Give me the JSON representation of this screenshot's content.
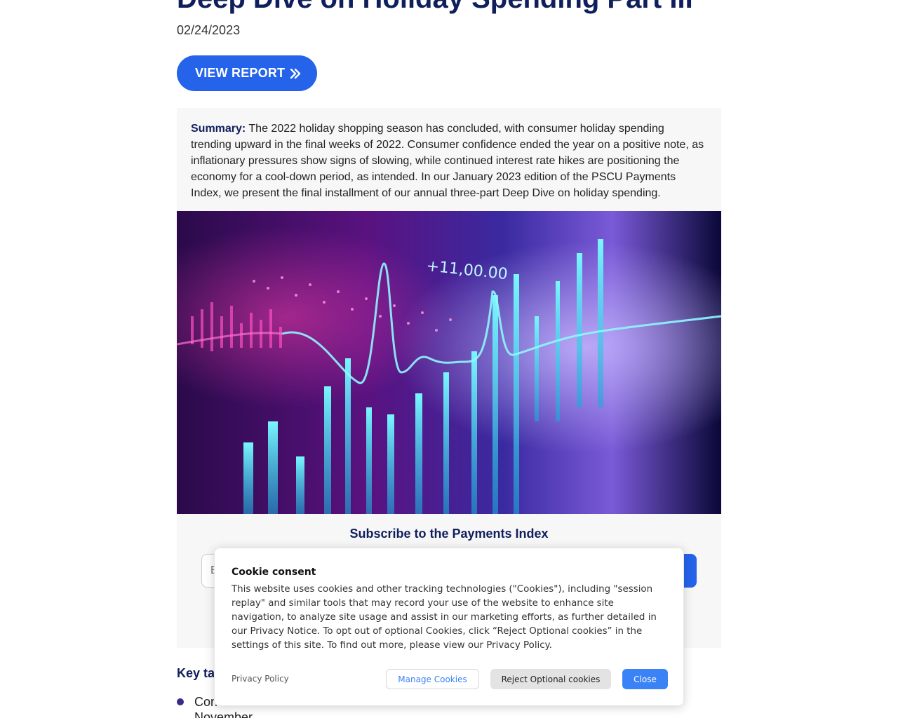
{
  "article": {
    "title": "Deep Dive on Holiday Spending Part III",
    "date": "02/24/2023",
    "view_report_label": "VIEW REPORT",
    "summary_label": "Summary:",
    "summary_text": " The 2022 holiday shopping season has concluded, with consumer holiday spending trending upward in the final weeks of 2022. Consumer confidence ended the year on a positive note, as inflationary pressures show signs of slowing, while continued interest rate hikes are positioning the economy for a cool-down period, as intended. In our January 2023 edition of the PSCU Payments Index, we present the final installment of our annual three-part Deep Dive on holiday spending.",
    "hero_image_text": "+11,00.00"
  },
  "subscribe": {
    "title": "Subscribe to the Payments Index",
    "email_placeholder": "E"
  },
  "key_takeaways": {
    "title": "Key ta",
    "items": [
      "Con",
      "November"
    ]
  },
  "cookie_consent": {
    "title": "Cookie consent",
    "text": "This website uses cookies and other tracking technologies (\"Cookies\"), including \"session replay\" and similar tools that may record your use of the website to enhance site navigation, to analyze site usage and assist in our marketing efforts, as further detailed in our Privacy Notice. To opt out of optional Cookies, click “Reject Optional cookies” in the settings of this site. To find out more, please view our Privacy Policy.",
    "privacy_policy_label": "Privacy Policy",
    "manage_label": "Manage Cookies",
    "reject_label": "Reject Optional cookies",
    "close_label": "Close"
  },
  "colors": {
    "brand_navy": "#0f1f5c",
    "accent_blue": "#2563eb",
    "cookie_blue": "#3b82f6"
  }
}
